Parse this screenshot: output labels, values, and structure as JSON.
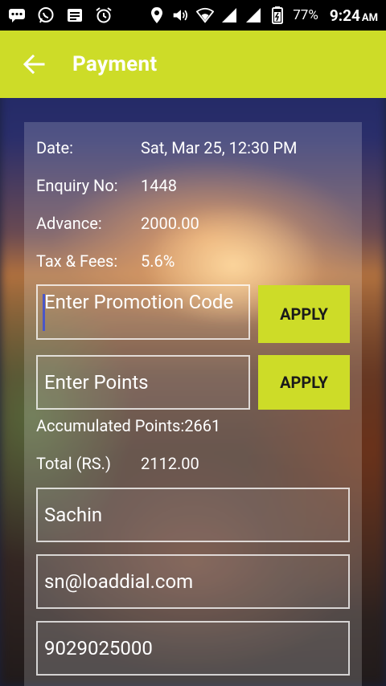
{
  "status_bar": {
    "battery": "77%",
    "time": "9:24",
    "ampm": "AM"
  },
  "toolbar": {
    "title": "Payment",
    "bg_color": "#cddc28"
  },
  "details": {
    "date_label": "Date:",
    "date_value": "Sat, Mar 25, 12:30 PM",
    "enquiry_label": "Enquiry No:",
    "enquiry_value": "1448",
    "advance_label": "Advance:",
    "advance_value": "2000.00",
    "tax_label": "Tax & Fees:",
    "tax_value": "5.6%"
  },
  "promo": {
    "placeholder": "Enter Promotion Code",
    "apply_label": "APPLY"
  },
  "points": {
    "placeholder": "Enter Points",
    "apply_label": "APPLY",
    "accumulated_text": "Accumulated Points:2661"
  },
  "total": {
    "label": "Total (RS.)",
    "value": "2112.00"
  },
  "contact": {
    "name": "Sachin",
    "email": "sn@loaddial.com",
    "phone": "9029025000"
  }
}
